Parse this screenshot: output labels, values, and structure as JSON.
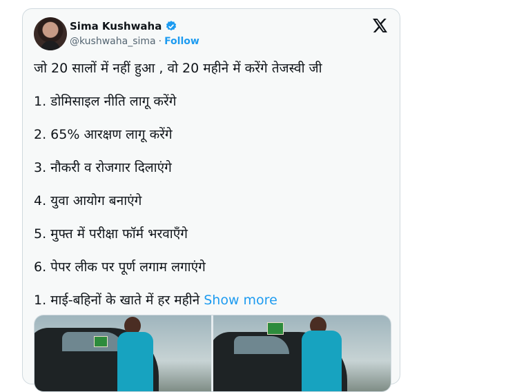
{
  "author": {
    "name": "Sima Kushwaha",
    "handle": "@kushwaha_sima",
    "separator": "·",
    "follow_label": "Follow",
    "verified": true
  },
  "platform_icon": "x-logo-icon",
  "tweet": {
    "lines": [
      "जो 20 सालों में नहीं हुआ , वो 20 महीने में करेंगे तेजस्वी जी",
      "1. डोमिसाइल नीति लागू करेंगे",
      "2. 65% आरक्षण लागू करेंगे",
      "3. नौकरी व रोजगार दिलाएंगे",
      "4. युवा आयोग बनाएंगे",
      "5. मुफ्त में परीक्षा फॉर्म भरवाएँगे",
      "6. पेपर लीक पर पूर्ण लगाम लगाएंगे",
      "1. माई-बहिनों के खाते में हर महीने"
    ],
    "show_more_label": "Show more"
  },
  "colors": {
    "accent": "#1d9bf0",
    "card_bg": "#f7f9f9",
    "border": "#cfd9de",
    "text": "#0f1419",
    "muted": "#536471"
  }
}
